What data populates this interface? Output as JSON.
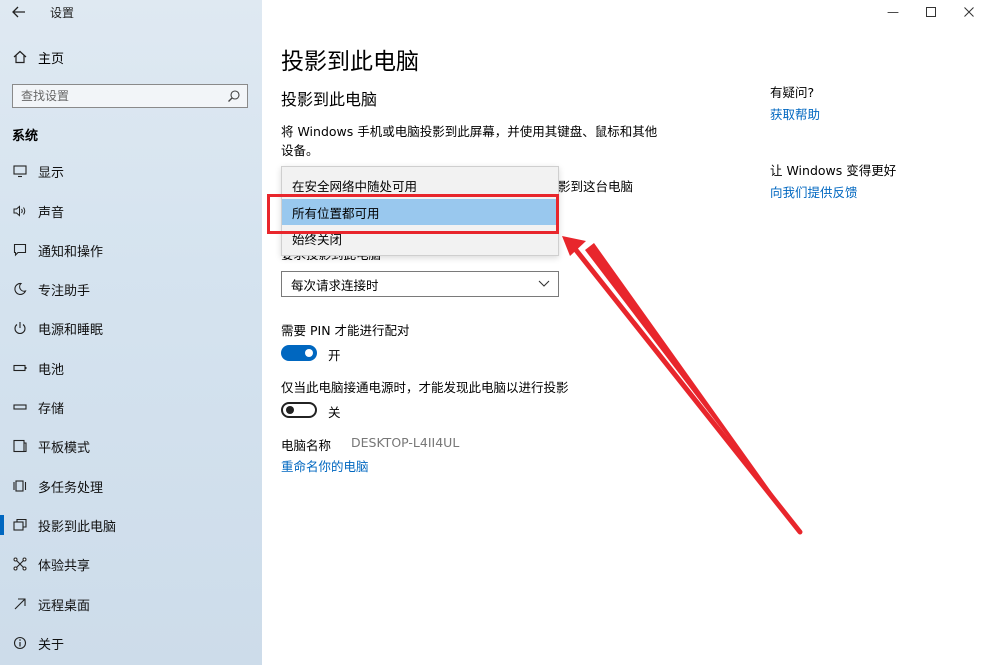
{
  "app": {
    "title": "设置"
  },
  "sidebar": {
    "home": "主页",
    "search_placeholder": "查找设置",
    "section": "系统",
    "items": [
      {
        "label": "显示",
        "icon": "monitor-icon"
      },
      {
        "label": "声音",
        "icon": "speaker-icon"
      },
      {
        "label": "通知和操作",
        "icon": "notification-icon"
      },
      {
        "label": "专注助手",
        "icon": "moon-icon"
      },
      {
        "label": "电源和睡眠",
        "icon": "power-icon"
      },
      {
        "label": "电池",
        "icon": "battery-icon"
      },
      {
        "label": "存储",
        "icon": "storage-icon"
      },
      {
        "label": "平板模式",
        "icon": "tablet-icon"
      },
      {
        "label": "多任务处理",
        "icon": "multitask-icon"
      },
      {
        "label": "投影到此电脑",
        "icon": "project-icon",
        "active": true
      },
      {
        "label": "体验共享",
        "icon": "share-icon"
      },
      {
        "label": "远程桌面",
        "icon": "remote-icon"
      },
      {
        "label": "关于",
        "icon": "info-icon"
      }
    ]
  },
  "main": {
    "title": "投影到此电脑",
    "subtitle": "投影到此电脑",
    "description": "将 Windows 手机或电脑投影到此屏幕，并使用其键盘、鼠标和其他设备。",
    "behind_text": "影到这台电脑",
    "hidden_label": "要求投影到此电脑",
    "dropdown_options": [
      "在安全网络中随处可用",
      "所有位置都可用",
      "始终关闭"
    ],
    "connect_select": "每次请求连接时",
    "pin_label": "需要 PIN 才能进行配对",
    "pin_state": "开",
    "power_label": "仅当此电脑接通电源时，才能发现此电脑以进行投影",
    "power_state": "关",
    "pc_name_label": "电脑名称",
    "pc_name_value": "DESKTOP-L4II4UL",
    "rename_link": "重命名你的电脑"
  },
  "aside": {
    "question": "有疑问?",
    "help_link": "获取帮助",
    "better": "让 Windows 变得更好",
    "feedback_link": "向我们提供反馈"
  },
  "colors": {
    "accent": "#0067c0",
    "highlight": "#e8262c",
    "selected": "#99c8ee"
  }
}
